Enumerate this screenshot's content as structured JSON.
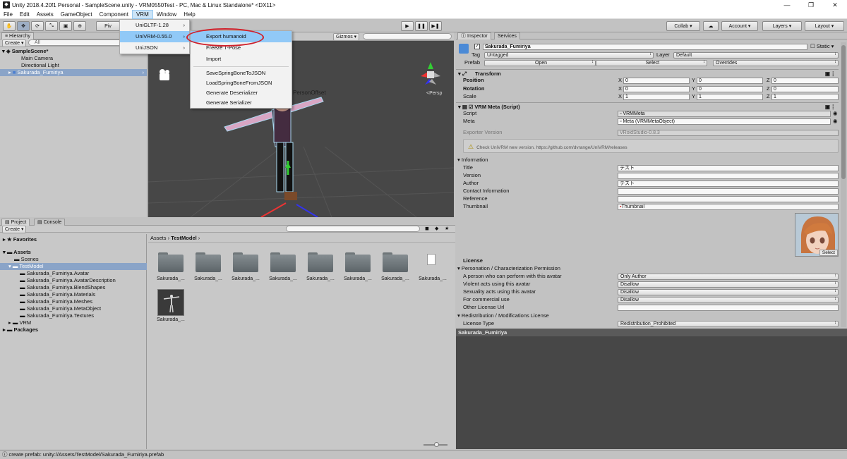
{
  "window": {
    "title": "Unity 2018.4.20f1 Personal - SampleScene.unity - VRM0550Test - PC, Mac & Linux Standalone* <DX11>"
  },
  "menubar": [
    "File",
    "Edit",
    "Assets",
    "GameObject",
    "Component",
    "VRM",
    "Window",
    "Help"
  ],
  "toolbar": {
    "pivot": "Piv",
    "collab": "Collab ▾",
    "account": "Account",
    "layers": "Layers",
    "layout": "Layout"
  },
  "hierarchy": {
    "tab": "Hierarchy",
    "create": "Create ▾",
    "search_placeholder": "All",
    "scene": "SampleScene*",
    "items": [
      "Main Camera",
      "Directional Light",
      "Sakurada_Fumiriya"
    ]
  },
  "scene_view": {
    "gizmos": "Gizmos ▾",
    "persp": "<Persp",
    "label": "PersonOffset"
  },
  "vrm_menu": {
    "items": [
      "UniGLTF-1.28",
      "UniVRM-0.55.0",
      "UniJSON"
    ],
    "submenu": [
      "Export humanoid",
      "Freeze T-Pose",
      "Import",
      "SaveSpringBoneToJSON",
      "LoadSpringBoneFromJSON",
      "Generate Deserializer",
      "Generate Serializer"
    ]
  },
  "project": {
    "tabs": [
      "Project",
      "Console"
    ],
    "create": "Create ▾",
    "favorites": "Favorites",
    "assets": "Assets",
    "tree": [
      "Scenes",
      "TestModel",
      "Sakurada_Fumiriya.Avatar",
      "Sakurada_Fumiriya.AvatarDescription",
      "Sakurada_Fumiriya.BlendShapes",
      "Sakurada_Fumiriya.Materials",
      "Sakurada_Fumiriya.Meshes",
      "Sakurada_Fumiriya.MetaObject",
      "Sakurada_Fumiriya.Textures",
      "VRM"
    ],
    "packages": "Packages",
    "breadcrumb": [
      "Assets",
      "TestModel"
    ],
    "grid_label": "Sakurada_..."
  },
  "inspector": {
    "tabs": [
      "Inspector",
      "Services"
    ],
    "object_name": "Sakurada_Fumiriya",
    "static": "Static",
    "tag_label": "Tag",
    "tag": "Untagged",
    "layer_label": "Layer",
    "layer": "Default",
    "prefab_label": "Prefab",
    "prefab_open": "Open",
    "prefab_select": "Select",
    "prefab_overrides": "Overrides",
    "transform": {
      "title": "Transform",
      "rows": [
        {
          "label": "Position",
          "x": "0",
          "y": "0",
          "z": "0"
        },
        {
          "label": "Rotation",
          "x": "0",
          "y": "0",
          "z": "0"
        },
        {
          "label": "Scale",
          "x": "1",
          "y": "1",
          "z": "1"
        }
      ]
    },
    "vrm_meta": {
      "title": "VRM Meta (Script)",
      "script_label": "Script",
      "script": "VRMMeta",
      "meta_label": "Meta",
      "meta": "Meta (VRMMetaObject)",
      "exporter_label": "Exporter Version",
      "exporter": "VRoidStudio-0.8.3",
      "warning": "Check UniVRM new version. https://github.com/dvrange/UniVRM/releases",
      "information": "Information",
      "fields": [
        {
          "label": "Title",
          "value": "テスト"
        },
        {
          "label": "Version",
          "value": ""
        },
        {
          "label": "Author",
          "value": "テスト"
        },
        {
          "label": "Contact Information",
          "value": ""
        },
        {
          "label": "Reference",
          "value": ""
        },
        {
          "label": "Thumbnail",
          "value": "Thumbnail"
        }
      ],
      "thumb_select": "Select",
      "license": "License",
      "personation": "Personation / Characterization Permission",
      "license_rows": [
        {
          "label": "A person who can perform with this avatar",
          "value": "Only Author"
        },
        {
          "label": "Violent acts using this avatar",
          "value": "Disallow"
        },
        {
          "label": "Sexuality acts using this avatar",
          "value": "Disallow"
        },
        {
          "label": "For commercial use",
          "value": "Disallow"
        },
        {
          "label": "Other License Url",
          "value": ""
        }
      ],
      "redistribution": "Redistribution / Modifications License",
      "license_type_label": "License Type",
      "license_type": "Redistribution_Prohibited"
    }
  },
  "preview": {
    "title": "Sakurada_Fumiriya"
  },
  "status": {
    "text": "create prefab: unity://Assets/TestModel/Sakurada_Fumiriya.prefab"
  },
  "colors": {
    "highlight": "#91c9f7",
    "annotation_circle": "#d0202a",
    "selection": "#8aa4c8"
  }
}
